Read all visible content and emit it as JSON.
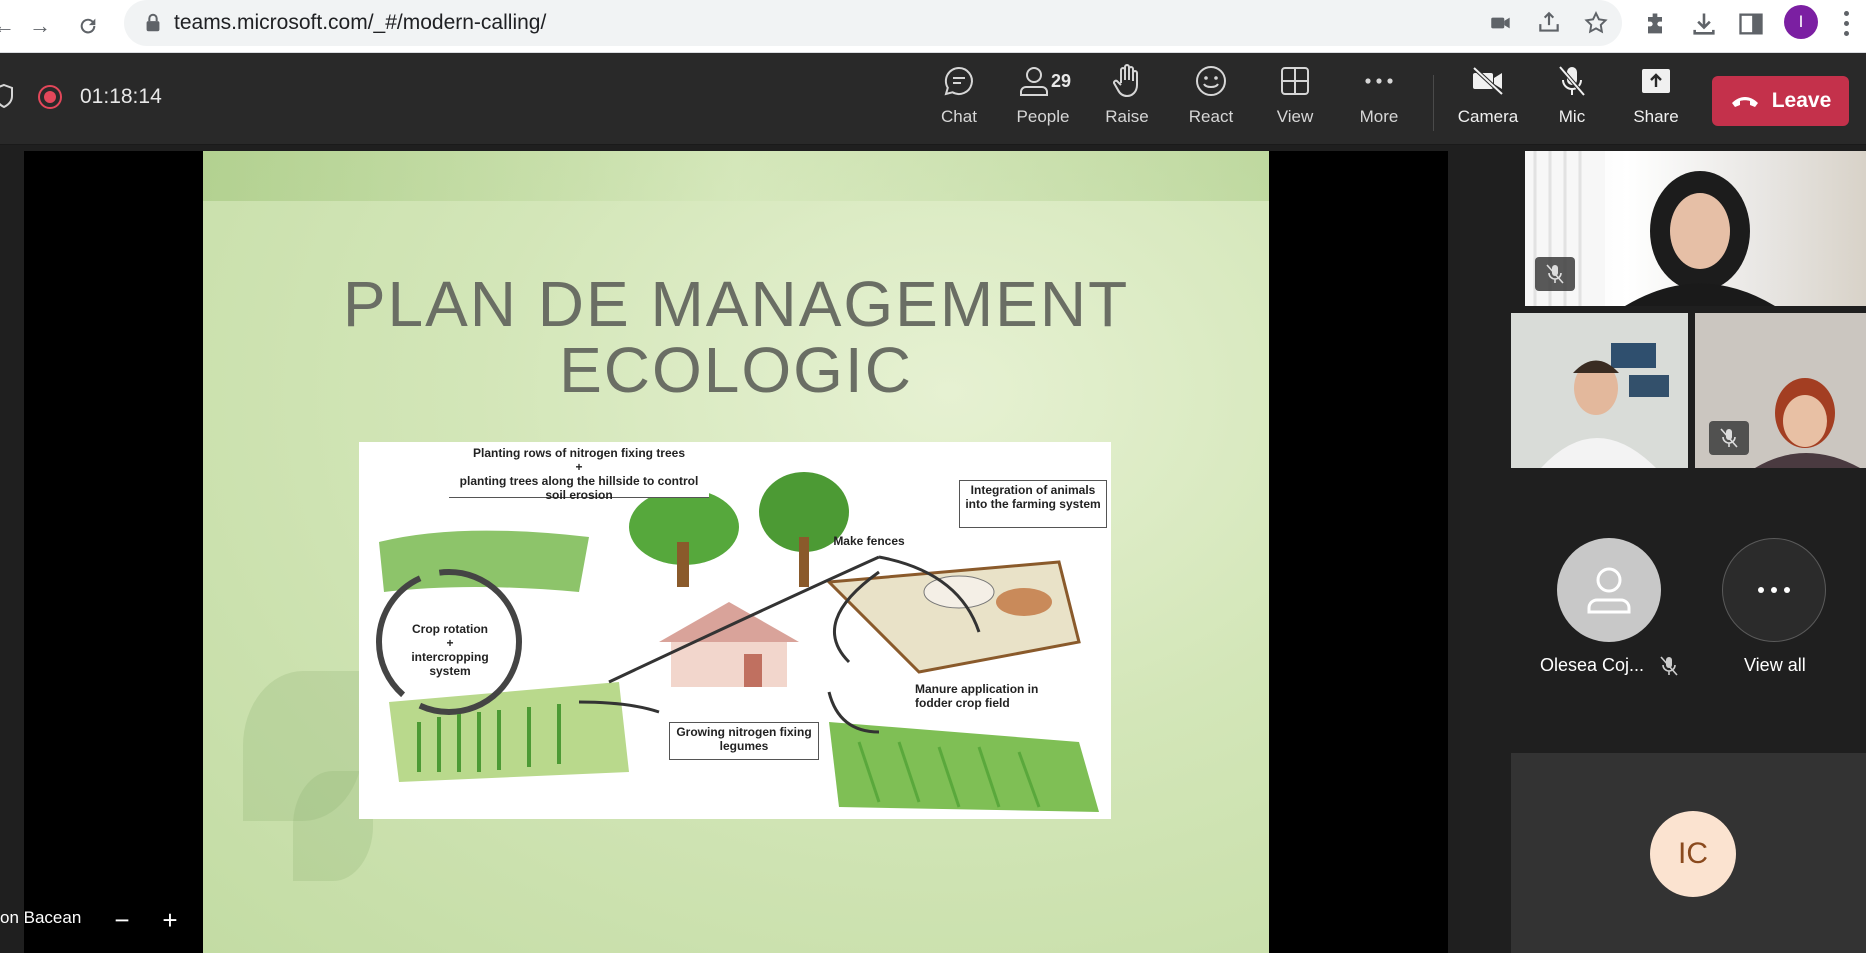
{
  "browser": {
    "url": "teams.microsoft.com/_#/modern-calling/",
    "profile_initial": "I"
  },
  "meeting": {
    "timer": "01:18:14",
    "toolbar": {
      "chat": "Chat",
      "people": "People",
      "people_count": "29",
      "raise": "Raise",
      "react": "React",
      "view": "View",
      "more": "More",
      "camera": "Camera",
      "mic": "Mic",
      "share": "Share",
      "leave": "Leave"
    },
    "colors": {
      "leave": "#c4314b",
      "active_tile": "#7f85f5",
      "recording": "#e3475a"
    }
  },
  "slide": {
    "title_line1": "PLAN DE MANAGEMENT",
    "title_line2": "ECOLOGIC",
    "diagram": {
      "top_box_line1": "Planting rows of nitrogen fixing trees",
      "top_box_plus": "+",
      "top_box_line2": "planting trees along the hillside to control",
      "top_box_line3": "soil erosion",
      "animals_box": "Integration of animals into the farming system",
      "fences": "Make fences",
      "crop_rotation_line1": "Crop rotation",
      "crop_rotation_plus": "+",
      "crop_rotation_line2": "intercropping",
      "crop_rotation_line3": "system",
      "manure": "Manure application in fodder crop field",
      "legumes": "Growing nitrogen fixing legumes"
    }
  },
  "stage": {
    "presenter_name": "on Bacean",
    "zoom_out": "−",
    "zoom_in": "+"
  },
  "gallery": {
    "participant_name": "Olesea Coj...",
    "view_all": "View all",
    "ic_initials": "IC"
  }
}
